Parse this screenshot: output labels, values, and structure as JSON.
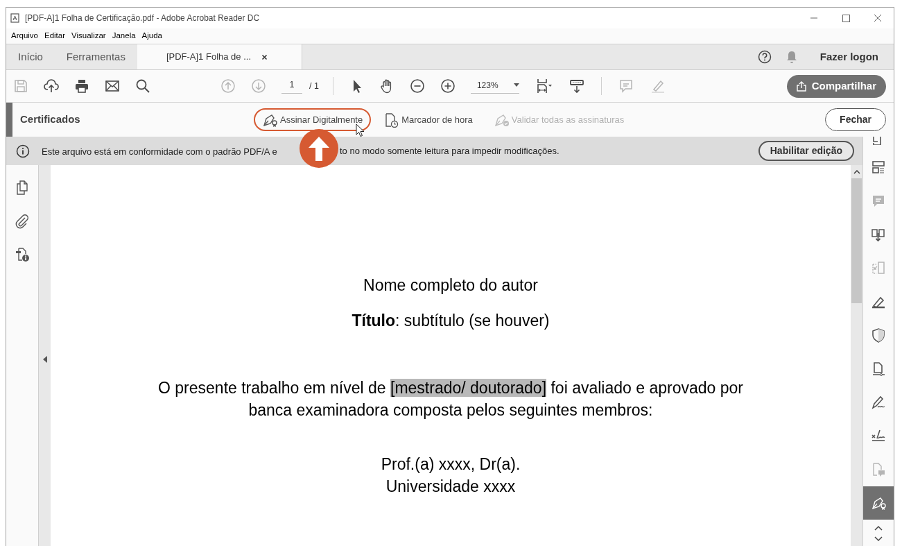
{
  "window": {
    "title": "[PDF-A]1 Folha de Certificação.pdf - Adobe Acrobat Reader DC"
  },
  "menu": [
    "Arquivo",
    "Editar",
    "Visualizar",
    "Janela",
    "Ajuda"
  ],
  "tabs": [
    {
      "label": "Início",
      "selected": false,
      "closable": false
    },
    {
      "label": "Ferramentas",
      "selected": false,
      "closable": false
    },
    {
      "label": "[PDF-A]1 Folha de ...",
      "selected": true,
      "closable": true
    }
  ],
  "header_right": {
    "sign_in": "Fazer logon"
  },
  "toolbar": {
    "file_tools": [
      {
        "kind": "save",
        "disabled": true
      },
      {
        "kind": "upload",
        "disabled": false
      },
      {
        "kind": "print",
        "disabled": false
      },
      {
        "kind": "mail",
        "disabled": false
      },
      {
        "kind": "search",
        "disabled": false
      }
    ],
    "nav": [
      {
        "kind": "prev",
        "disabled": true
      },
      {
        "kind": "next",
        "disabled": true
      }
    ],
    "page": {
      "current": "1",
      "total": "/ 1"
    },
    "tools": [
      {
        "kind": "select",
        "disabled": false
      },
      {
        "kind": "hand",
        "disabled": false
      },
      {
        "kind": "zoom_out",
        "disabled": false
      },
      {
        "kind": "zoom_in",
        "disabled": false
      }
    ],
    "zoom": "123%",
    "view": [
      {
        "kind": "fit",
        "disabled": false
      },
      {
        "kind": "scroll",
        "disabled": false
      }
    ],
    "annotate": [
      {
        "kind": "comment",
        "disabled": true
      },
      {
        "kind": "highlight",
        "disabled": true
      }
    ],
    "share_button": "Compartilhar"
  },
  "tool_bar": {
    "title": "Certificados",
    "actions": [
      {
        "kind": "sign",
        "label": "Assinar Digitalmente",
        "disabled": false,
        "highlighted": true
      },
      {
        "kind": "timestamp",
        "label": "Marcador de hora",
        "disabled": false,
        "highlighted": false
      },
      {
        "kind": "validate",
        "label": "Validar todas as assinaturas",
        "disabled": true,
        "highlighted": false
      }
    ],
    "close_button": "Fechar"
  },
  "info_bar": {
    "text_before": "Este arquivo está em conformidade com o padrão PDF/A e",
    "text_after": "to no modo somente leitura para impedir modificações.",
    "button": "Habilitar edição"
  },
  "left_panel": [
    {
      "kind": "pages"
    },
    {
      "kind": "attachments"
    },
    {
      "kind": "properties"
    }
  ],
  "document": {
    "author": "Nome completo do autor",
    "title": "**Título**: subtítulo (se houver)",
    "paragraph": {
      "before": "O presente trabalho em nível de ",
      "highlighted": "[mestrado/ doutorado]",
      "after": " foi avaliado e aprovado por banca examinadora composta pelos seguintes membros:"
    },
    "member_lines": [
      "Prof.(a) xxxx, Dr(a).",
      "Universidade xxxx"
    ]
  },
  "right_rail": [
    {
      "kind": "organize",
      "disabled": false,
      "selected": false
    },
    {
      "kind": "layout",
      "disabled": false,
      "selected": false
    },
    {
      "kind": "comment",
      "disabled": true,
      "selected": false
    },
    {
      "kind": "export",
      "disabled": false,
      "selected": false
    },
    {
      "kind": "compare",
      "disabled": true,
      "selected": false
    },
    {
      "kind": "edit",
      "disabled": false,
      "selected": false
    },
    {
      "kind": "protect",
      "disabled": false,
      "selected": false
    },
    {
      "kind": "form",
      "disabled": false,
      "selected": false
    },
    {
      "kind": "sign",
      "disabled": false,
      "selected": false
    },
    {
      "kind": "stamp",
      "disabled": false,
      "selected": false
    },
    {
      "kind": "send_comment",
      "disabled": true,
      "selected": false
    },
    {
      "kind": "certificate",
      "disabled": false,
      "selected": true
    }
  ]
}
